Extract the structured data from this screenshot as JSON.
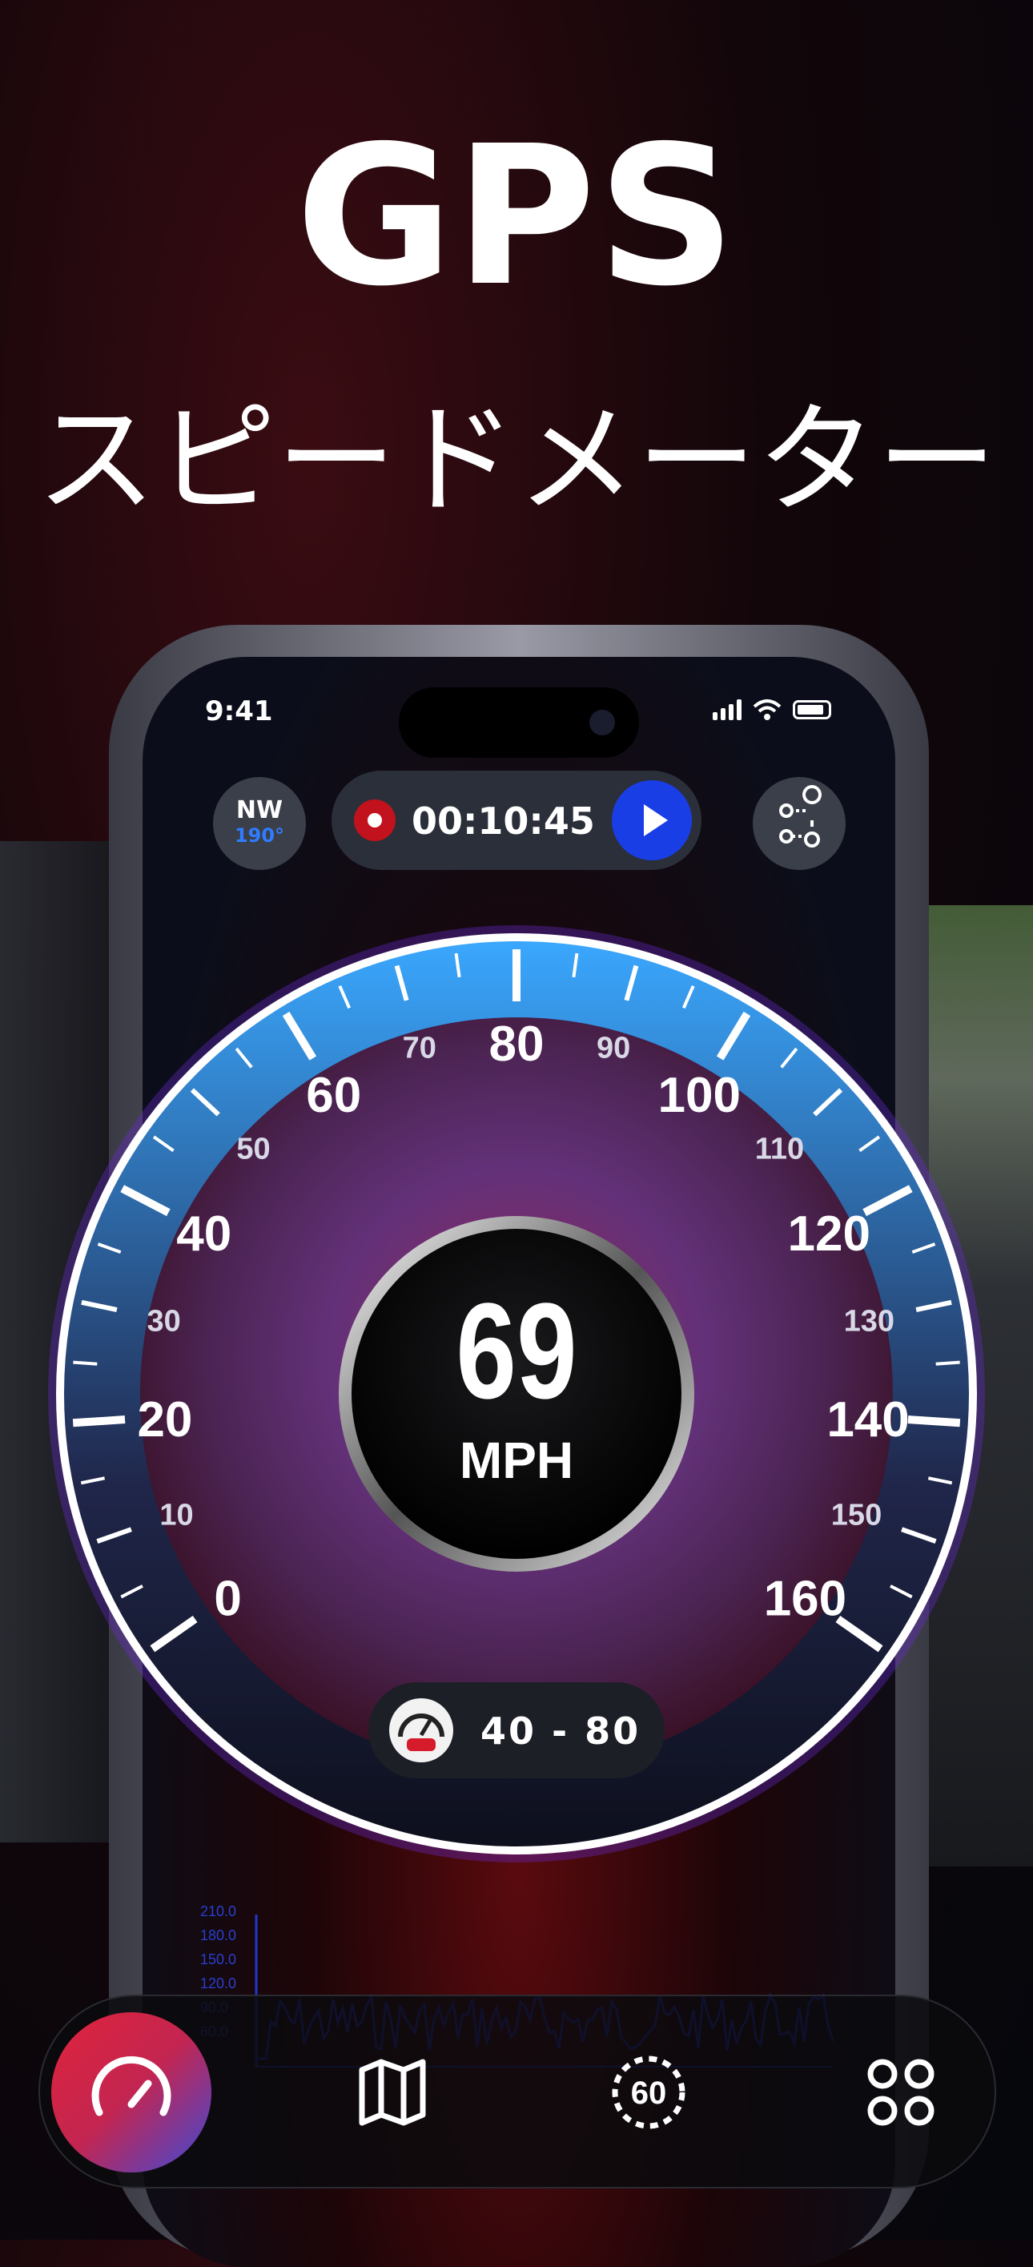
{
  "headline": {
    "title": "GPS",
    "subtitle": "スピードメーター"
  },
  "status_bar": {
    "time": "9:41"
  },
  "compass": {
    "direction": "NW",
    "degrees": "190°"
  },
  "trip": {
    "timer": "00:10:45"
  },
  "gauge": {
    "major_ticks": [
      "0",
      "20",
      "40",
      "60",
      "80",
      "100",
      "120",
      "140",
      "160"
    ],
    "minor_ticks": [
      "10",
      "30",
      "50",
      "70",
      "90",
      "110",
      "130",
      "150"
    ],
    "min": 0,
    "max": 160,
    "needle_value": 69,
    "speed": "69",
    "unit": "MPH"
  },
  "speed_range": {
    "label": "40 - 80"
  },
  "mini_chart": {
    "y_ticks": [
      "210.0",
      "180.0",
      "150.0",
      "120.0",
      "90.0",
      "60.0"
    ]
  },
  "tabbar": {
    "tabs": [
      {
        "name": "speedometer",
        "active": true
      },
      {
        "name": "map",
        "active": false
      },
      {
        "name": "speed-limit",
        "active": false,
        "label": "60"
      },
      {
        "name": "more",
        "active": false
      }
    ]
  }
}
